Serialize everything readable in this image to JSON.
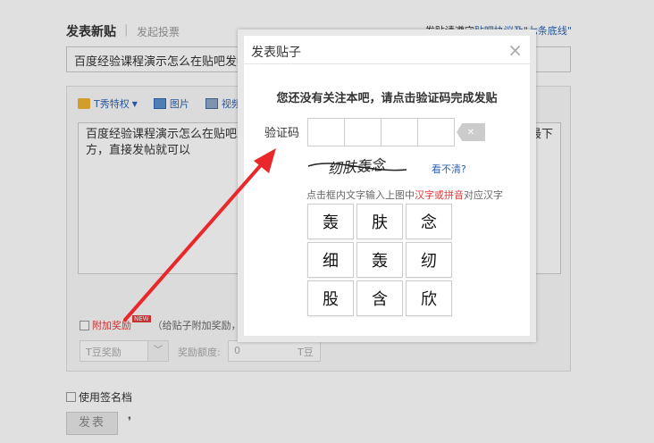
{
  "page": {
    "header": {
      "title": "发表新贴",
      "separator": "|",
      "vote": "发起投票",
      "notice_prefix": "发贴请遵守",
      "notice_link": "贴吧协议及\"七条底线\""
    },
    "title_input": {
      "value": "百度经验课程演示怎么在贴吧发帖"
    },
    "toolbar": {
      "tshow": "T秀特权",
      "image": "图片",
      "video": "视频"
    },
    "editor": {
      "content_line1": "百度经验课程演示怎么在贴吧发",
      "content_tail1": "最下",
      "content_line2": "方，直接发帖就可以"
    },
    "reward": {
      "label": "附加奖励",
      "badge": "NEW",
      "desc": "（给贴子附加奖励，会增加",
      "select_value": "T豆奖励",
      "amount_label": "奖励额度:",
      "amount_value": "0",
      "amount_unit": "T豆"
    },
    "signature": {
      "label": "使用签名档"
    },
    "submit": {
      "label": "发表"
    }
  },
  "dialog": {
    "title": "发表贴子",
    "close": "×",
    "prompt": "您还没有关注本吧，请点击验证码完成发贴",
    "code_label": "验证码",
    "clear": "✕",
    "refresh": "看不清?",
    "instruction_pre": "点击框内文字输入上图中",
    "instruction_hl": "汉字或拼音",
    "instruction_post": "对应汉字",
    "captcha_text": "纫肤轰念",
    "chars": [
      "轰",
      "肤",
      "念",
      "细",
      "轰",
      "纫",
      "股",
      "含",
      "欣"
    ]
  },
  "colors": {
    "link": "#2d64b3",
    "highlight": "#e23b3b",
    "arrow": "#e8282b"
  }
}
